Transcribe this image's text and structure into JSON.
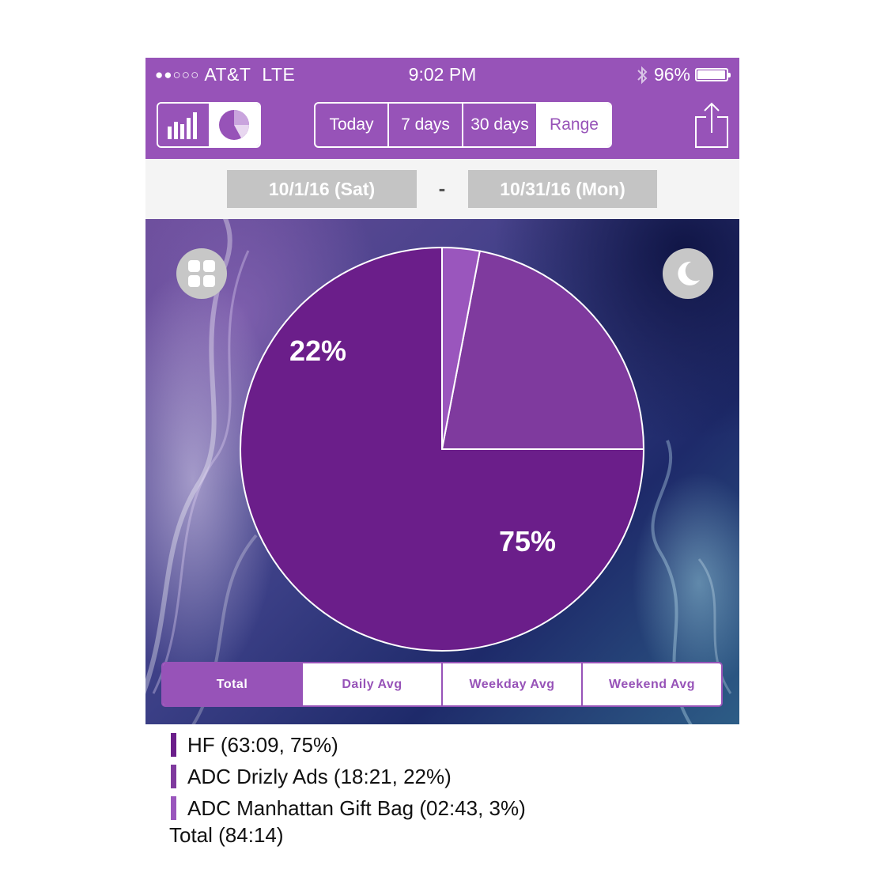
{
  "status_bar": {
    "carrier": "AT&T",
    "network": "LTE",
    "time": "9:02 PM",
    "battery": "96%",
    "battery_level": 0.96,
    "signal_bars": 2,
    "signal_total": 5
  },
  "toolbar": {
    "view_modes": [
      "bar-chart-icon",
      "pie-chart-icon"
    ],
    "active_view": "pie",
    "range_tabs": [
      {
        "label": "Today",
        "active": false
      },
      {
        "label": "7 days",
        "active": false
      },
      {
        "label": "30 days",
        "active": false
      },
      {
        "label": "Range",
        "active": true
      }
    ]
  },
  "date_range": {
    "start": "10/1/16 (Sat)",
    "separator": "-",
    "end": "10/31/16 (Mon)"
  },
  "stat_tabs": [
    {
      "label": "Total",
      "active": true
    },
    {
      "label": "Daily Avg",
      "active": false
    },
    {
      "label": "Weekday Avg",
      "active": false
    },
    {
      "label": "Weekend Avg",
      "active": false
    }
  ],
  "chart_data": {
    "type": "pie",
    "slices": [
      {
        "label": "HF",
        "value": 75,
        "duration": "63:09",
        "color": "#6b1e8a",
        "data_label": "75%"
      },
      {
        "label": "ADC  Drizly Ads",
        "value": 22,
        "duration": "18:21",
        "color": "#7f3a9e",
        "data_label": "22%"
      },
      {
        "label": "ADC Manhattan Gift Bag",
        "value": 3,
        "duration": "02:43",
        "color": "#9a56bd",
        "data_label": ""
      }
    ]
  },
  "legend": [
    {
      "text": "HF (63:09, 75%)",
      "color": "#6b1e8a"
    },
    {
      "text": "ADC  Drizly Ads (18:21, 22%)",
      "color": "#7f3a9e"
    },
    {
      "text": "ADC Manhattan Gift Bag (02:43, 3%)",
      "color": "#9a56bd"
    }
  ],
  "total": "Total (84:14)"
}
